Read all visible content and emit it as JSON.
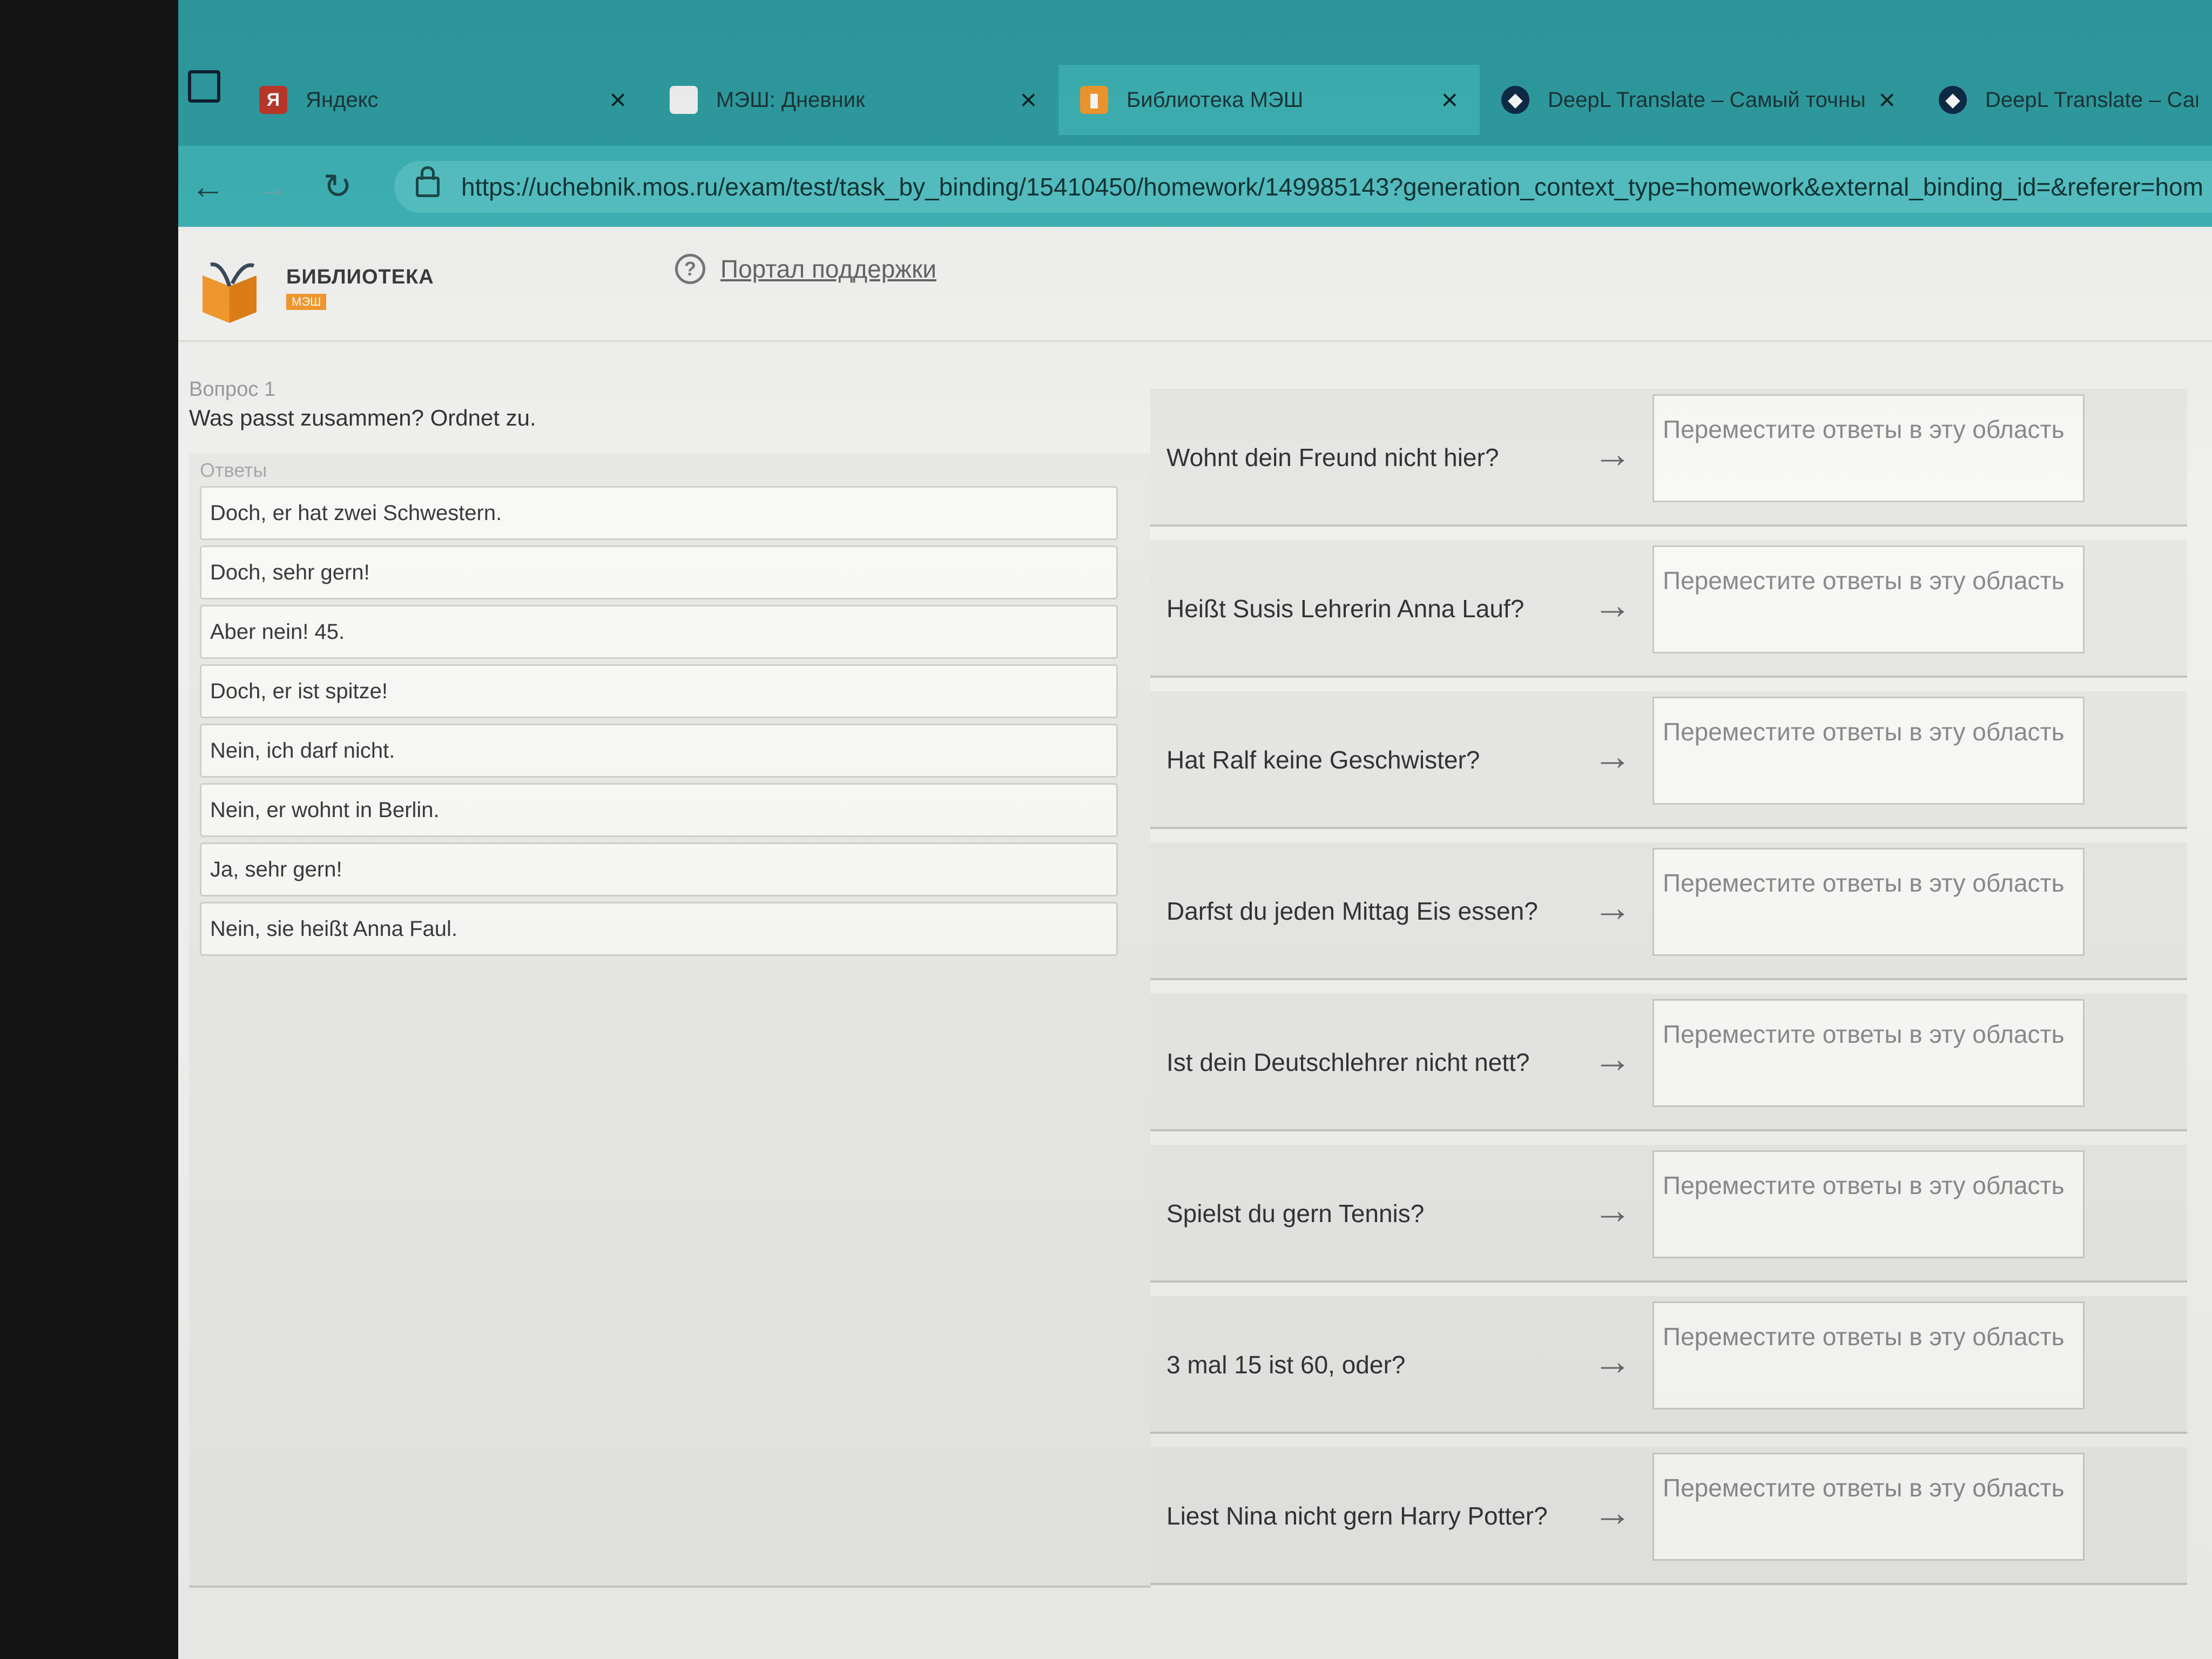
{
  "browser": {
    "tabs": [
      {
        "title": "Яндекс",
        "icon": "yandex-icon",
        "active": false
      },
      {
        "title": "МЭШ: Дневник",
        "icon": "page-icon",
        "active": false
      },
      {
        "title": "Библиотека МЭШ",
        "icon": "book-icon",
        "active": true
      },
      {
        "title": "DeepL Translate – Самый точны",
        "icon": "deepl-icon",
        "active": false
      },
      {
        "title": "DeepL Translate – Самый т",
        "icon": "deepl-icon",
        "active": false
      }
    ],
    "url": "https://uchebnik.mos.ru/exam/test/task_by_binding/15410450/homework/149985143?generation_context_type=homework&external_binding_id=&referer=hom",
    "colors": {
      "tabbar": "#2f9ea3",
      "toolbar": "#3eb3b6",
      "brand_orange": "#f39a2e"
    }
  },
  "site": {
    "logo_title": "БИБЛИОТЕКА",
    "logo_badge": "МЭШ",
    "support_link": "Портал поддержки"
  },
  "question": {
    "label": "Вопрос 1",
    "text": "Was passt zusammen? Ordnet zu.",
    "answers_label": "Ответы",
    "answers": [
      "Doch, er hat zwei Schwestern.",
      "Doch, sehr gern!",
      "Aber nein! 45.",
      "Doch, er ist spitze!",
      "Nein, ich darf nicht.",
      "Nein, er wohnt in Berlin.",
      "Ja, sehr gern!",
      "Nein, sie heißt Anna Faul."
    ],
    "drop_placeholder": "Переместите ответы в эту область",
    "items": [
      "Wohnt dein Freund nicht hier?",
      "Heißt Susis Lehrerin Anna Lauf?",
      "Hat Ralf keine Geschwister?",
      "Darfst du jeden Mittag Eis essen?",
      "Ist dein Deutschlehrer nicht nett?",
      "Spielst du gern Tennis?",
      "3 mal 15 ist 60, oder?",
      "Liest Nina nicht gern Harry Potter?"
    ]
  }
}
